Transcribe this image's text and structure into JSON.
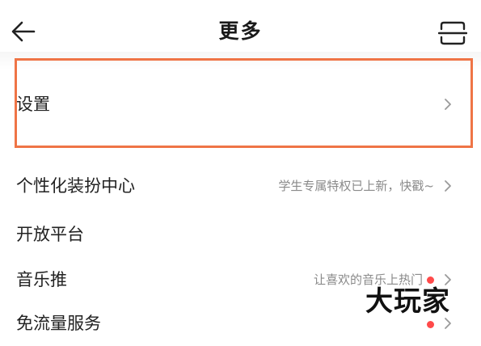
{
  "header": {
    "title": "更多",
    "back_icon": "arrow-left-icon",
    "scan_icon": "scan-icon"
  },
  "menu": {
    "items": [
      {
        "label": "设置",
        "subtitle": "",
        "icon": "chevron-right-icon"
      },
      {
        "label": "个性化装扮中心",
        "subtitle": "学生专属特权已上新，快戳~",
        "icon": "chevron-right-icon"
      },
      {
        "label": "开放平台",
        "subtitle": ""
      },
      {
        "label": "音乐推",
        "subtitle": "让喜欢的音乐上热门",
        "badge": "red-dot",
        "icon": "chevron-right-icon"
      },
      {
        "label": "免流量服务",
        "subtitle": "",
        "badge": "red-dot",
        "icon": "chevron-right-icon"
      }
    ]
  },
  "overlay": {
    "watermark": "大玩家",
    "highlight_color": "#ef7446"
  },
  "colors": {
    "accent": "#ef7446",
    "badge": "#ff4a4a",
    "subtext": "#8a8a8a"
  }
}
